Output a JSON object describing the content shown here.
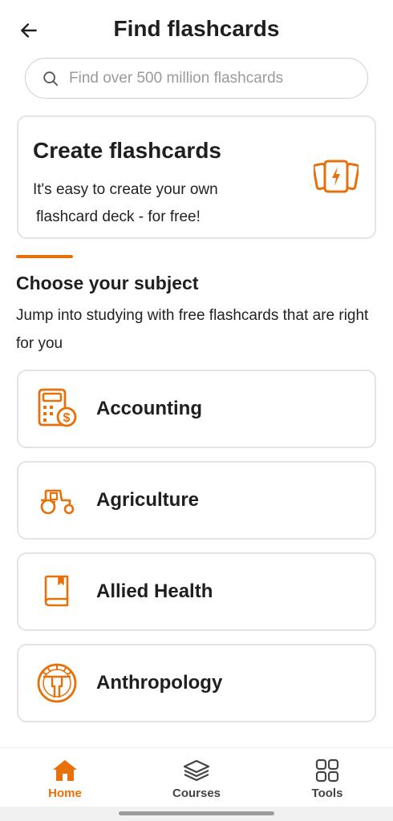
{
  "header": {
    "title": "Find flashcards",
    "back_icon": "arrow-left-icon"
  },
  "search": {
    "placeholder": "Find over 500 million flashcards",
    "value": "",
    "icon": "search-icon"
  },
  "create_card": {
    "title": "Create flashcards",
    "description_line1": "It's easy to create your own",
    "description_line2": "flashcard deck - for free!",
    "icon": "flashcards-lightning-icon"
  },
  "subjects_section": {
    "title": "Choose your subject",
    "description": "Jump into studying with free flashcards that are right for you",
    "items": [
      {
        "label": "Accounting",
        "icon": "calculator-dollar-icon"
      },
      {
        "label": "Agriculture",
        "icon": "tractor-icon"
      },
      {
        "label": "Allied Health",
        "icon": "book-icon"
      },
      {
        "label": "Anthropology",
        "icon": "human-figure-circle-icon"
      }
    ]
  },
  "bottom_nav": {
    "items": [
      {
        "label": "Home",
        "icon": "home-icon",
        "active": true
      },
      {
        "label": "Courses",
        "icon": "layers-icon",
        "active": false
      },
      {
        "label": "Tools",
        "icon": "grid-icon",
        "active": false
      }
    ]
  },
  "colors": {
    "accent": "#e8700a",
    "text": "#1f1f1f",
    "border": "#e4e4e4"
  }
}
